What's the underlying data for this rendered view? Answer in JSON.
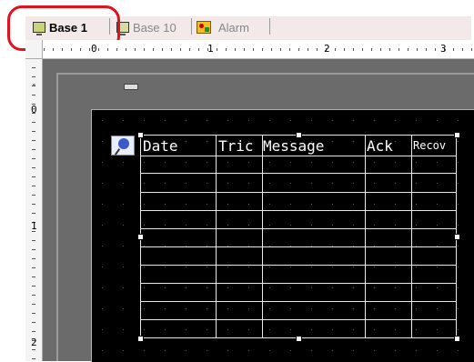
{
  "tabs": [
    {
      "label": "Base 1",
      "active": true,
      "icon": "screen-icon"
    },
    {
      "label": "Base 10",
      "active": false,
      "icon": "screen-icon"
    },
    {
      "label": "Alarm",
      "active": false,
      "icon": "alarm-icon"
    }
  ],
  "ruler": {
    "horizontal": [
      "0",
      "1",
      "2",
      "3"
    ],
    "vertical": [
      "-",
      "0",
      "1",
      "2"
    ]
  },
  "alarm_table": {
    "headers": [
      "Date",
      "Tric",
      "Message",
      "Ack",
      "Recov"
    ],
    "icon": "pin-icon"
  },
  "colors": {
    "highlight": "#e0121b",
    "canvas": "#000000",
    "workspace": "#6b6b6b"
  }
}
